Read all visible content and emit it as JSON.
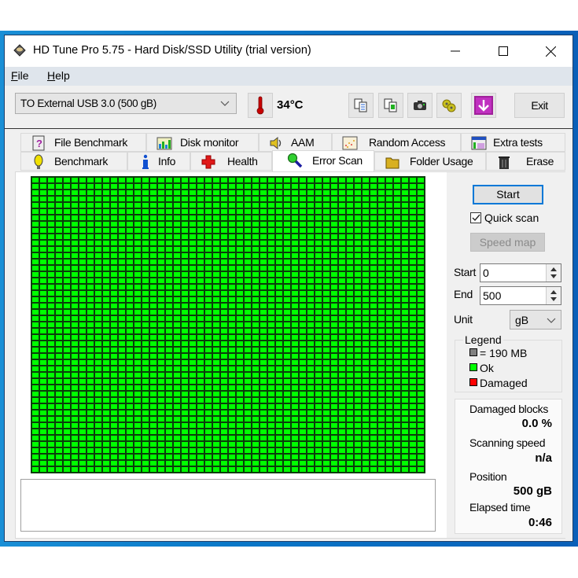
{
  "window": {
    "title": "HD Tune Pro 5.75 - Hard Disk/SSD Utility (trial version)",
    "icon": "hard-disk-icon",
    "controls": [
      "minimize-icon",
      "maximize-icon",
      "close-icon"
    ]
  },
  "menu": {
    "items": [
      {
        "label": "File",
        "mnemonic": "F",
        "rest": "ile"
      },
      {
        "label": "Help",
        "mnemonic": "H",
        "rest": "elp"
      }
    ]
  },
  "toolbar": {
    "drive": "TO External USB 3.0 (500 gB)",
    "temperature": "34°C",
    "temperature_display": "34",
    "temperature_unit": "°C",
    "buttons": [
      "copy-info-icon",
      "copy-screenshot-icon",
      "camera-icon",
      "options-gear-icon",
      "download-icon"
    ],
    "exit_label": "Exit"
  },
  "tabs": {
    "row1": [
      {
        "label": "File Benchmark",
        "icon": "file-benchmark-icon"
      },
      {
        "label": "Disk monitor",
        "icon": "disk-monitor-icon"
      },
      {
        "label": "AAM",
        "icon": "speaker-icon"
      },
      {
        "label": "Random Access",
        "icon": "random-access-icon"
      },
      {
        "label": "Extra tests",
        "icon": "extra-tests-icon"
      }
    ],
    "row2": [
      {
        "label": "Benchmark",
        "icon": "benchmark-icon"
      },
      {
        "label": "Info",
        "icon": "info-icon"
      },
      {
        "label": "Health",
        "icon": "health-cross-icon"
      },
      {
        "label": "Error Scan",
        "icon": "magnifier-icon",
        "active": true
      },
      {
        "label": "Folder Usage",
        "icon": "folder-icon"
      },
      {
        "label": "Erase",
        "icon": "trash-icon"
      }
    ]
  },
  "error_scan": {
    "grid": {
      "columns": 50,
      "rows": 47,
      "status": "ok"
    },
    "colors": {
      "ok": "#00ff00",
      "damaged": "#ff0000",
      "unscanned": "#808080",
      "grid_line": "#0b3d0b"
    },
    "log_text": "",
    "start_label": "Start",
    "quick_scan_label": "Quick scan",
    "quick_scan_checked": true,
    "speed_map_label": "Speed map",
    "start_field_label": "Start",
    "start_value": "0",
    "end_field_label": "End",
    "end_value": "500",
    "unit_label": "Unit",
    "unit_value": "gB",
    "legend": {
      "title": "Legend",
      "block_size": "= 190 MB",
      "ok": "Ok",
      "damaged": "Damaged"
    },
    "stats": {
      "damaged_blocks_label": "Damaged blocks",
      "damaged_blocks_value": "0.0 %",
      "scanning_speed_label": "Scanning speed",
      "scanning_speed_value": "n/a",
      "position_label": "Position",
      "position_value": "500 gB",
      "elapsed_label": "Elapsed time",
      "elapsed_value": "0:46"
    }
  }
}
